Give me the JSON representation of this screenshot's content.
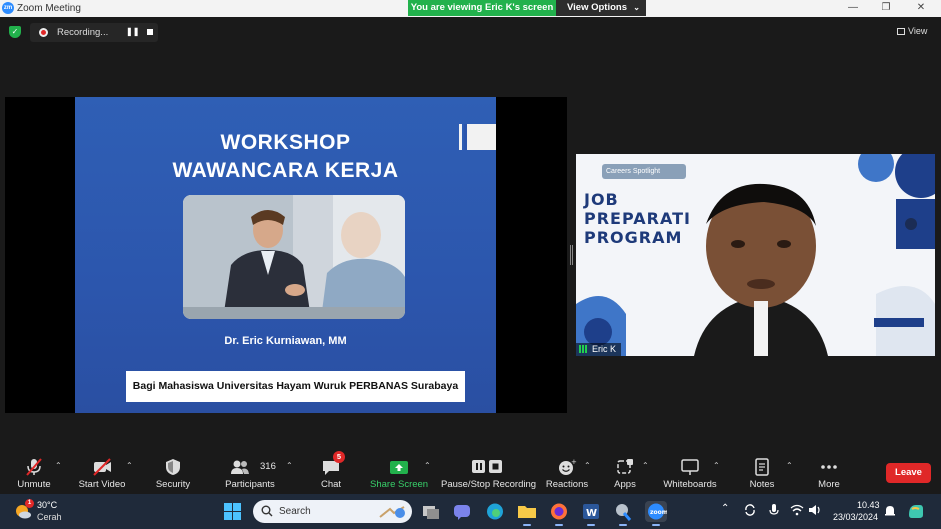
{
  "titlebar": {
    "app_logo": "zm",
    "title": "Zoom Meeting",
    "viewing_banner": "You are viewing Eric K's screen",
    "view_options_label": "View Options",
    "minimize": "—",
    "restore": "❐",
    "close": "✕"
  },
  "meeting_bar": {
    "recording_label": "Recording...",
    "view_label": "View"
  },
  "shared_slide": {
    "title_line1": "WORKSHOP",
    "title_line2": "WAWANCARA KERJA",
    "author": "Dr. Eric Kurniawan, MM",
    "banner": "Bagi Mahasiswa Universitas Hayam Wuruk PERBANAS Surabaya"
  },
  "speaker": {
    "name": "Eric K",
    "bg_line1": "JOB",
    "bg_line2": "PREPARATI",
    "bg_line3": "PROGRAM",
    "careers_badge": "Careers Spotlight"
  },
  "toolbar": {
    "unmute": "Unmute",
    "start_video": "Start Video",
    "security": "Security",
    "participants": "Participants",
    "participants_count": "316",
    "chat": "Chat",
    "chat_badge": "5",
    "share_screen": "Share Screen",
    "pause_stop_recording": "Pause/Stop Recording",
    "reactions": "Reactions",
    "apps": "Apps",
    "whiteboards": "Whiteboards",
    "notes": "Notes",
    "more": "More",
    "leave": "Leave"
  },
  "taskbar": {
    "weather_badge": "1",
    "weather_temp": "30°C",
    "weather_condition": "Cerah",
    "search_placeholder": "Search",
    "time": "10.43",
    "date": "23/03/2024"
  },
  "colors": {
    "banner_green": "#22b14c",
    "slide_blue": "#2f5fb5",
    "leave_red": "#e02828",
    "share_green": "#38d06a",
    "taskbar_bg": "#1f2a3a"
  }
}
